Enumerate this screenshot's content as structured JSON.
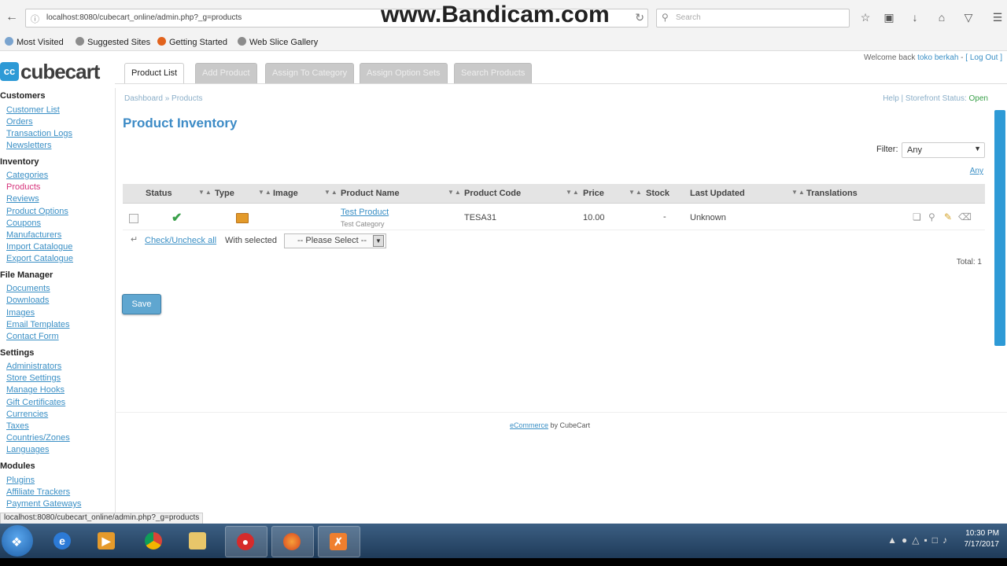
{
  "watermark": "www.Bandicam.com",
  "browser": {
    "url": "localhost:8080/cubecart_online/admin.php?_g=products",
    "search_placeholder": "Search",
    "bookmarks": [
      "Most Visited",
      "Suggested Sites",
      "Getting Started",
      "Web Slice Gallery"
    ],
    "status_url": "localhost:8080/cubecart_online/admin.php?_g=products"
  },
  "app": {
    "logo": "cubecart",
    "welcome_prefix": "Welcome back",
    "welcome_user": "toko berkah",
    "logout": "[ Log Out ]",
    "tabs": [
      "Product List",
      "Add Product",
      "Assign To Category",
      "Assign Option Sets",
      "Search Products"
    ]
  },
  "sidebar": {
    "customers": {
      "heading": "Customers",
      "items": [
        "Customer List",
        "Orders",
        "Transaction Logs",
        "Newsletters"
      ]
    },
    "inventory": {
      "heading": "Inventory",
      "items": [
        "Categories",
        "Products",
        "Reviews",
        "Product Options",
        "Coupons",
        "Manufacturers",
        "Import Catalogue",
        "Export Catalogue"
      ]
    },
    "filemanager": {
      "heading": "File Manager",
      "items": [
        "Documents",
        "Downloads",
        "Images",
        "Email Templates",
        "Contact Form"
      ]
    },
    "settings": {
      "heading": "Settings",
      "items": [
        "Administrators",
        "Store Settings",
        "Manage Hooks",
        "Gift Certificates",
        "Currencies",
        "Taxes",
        "Countries/Zones",
        "Languages"
      ]
    },
    "modules": {
      "heading": "Modules",
      "items": [
        "Plugins",
        "Affiliate Trackers",
        "Payment Gateways"
      ]
    }
  },
  "main": {
    "breadcrumb": "Dashboard » Products",
    "help": "Help",
    "storefront": "Storefront Status:",
    "storefront_status": "Open",
    "title": "Product Inventory",
    "filter_label": "Filter:",
    "filter_value": "Any",
    "any_link": "Any",
    "columns": [
      "Status",
      "Type",
      "Image",
      "Product Name",
      "Product Code",
      "Price",
      "Stock",
      "Last Updated",
      "Translations"
    ],
    "row": {
      "name": "Test Product",
      "category": "Test Category",
      "code": "TESA31",
      "price": "10.00",
      "stock": "-",
      "updated": "Unknown"
    },
    "bulk_check": "Check/Uncheck all",
    "bulk_with": "With selected",
    "bulk_select": "-- Please Select --",
    "total": "Total: 1",
    "save": "Save",
    "footer_link": "eCommerce",
    "footer_by": "by CubeCart"
  },
  "taskbar": {
    "time": "10:30 PM",
    "date": "7/17/2017"
  }
}
